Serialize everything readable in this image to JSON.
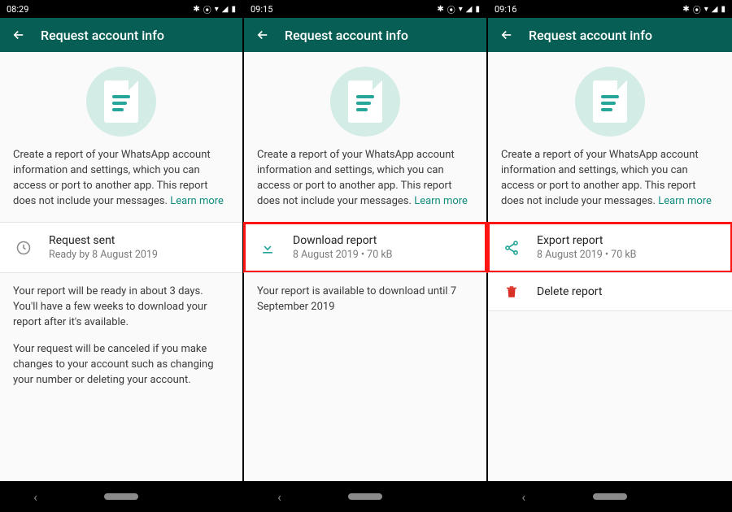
{
  "screens": [
    {
      "status_time": "08:29",
      "appbar_title": "Request account info",
      "description": "Create a report of your WhatsApp account information and settings, which you can access or port to another app. This report does not include your messages.",
      "learn_more": "Learn more",
      "item": {
        "icon": "clock",
        "primary": "Request sent",
        "secondary": "Ready by 8 August 2019",
        "highlighted": false
      },
      "note1": "Your report will be ready in about 3 days. You'll have a few weeks to download your report after it's available.",
      "note2": "Your request will be canceled if you make changes to your account such as changing your number or deleting your account."
    },
    {
      "status_time": "09:15",
      "appbar_title": "Request account info",
      "description": "Create a report of your WhatsApp account information and settings, which you can access or port to another app. This report does not include your messages.",
      "learn_more": "Learn more",
      "item": {
        "icon": "download",
        "primary": "Download report",
        "secondary": "8 August 2019 • 70 kB",
        "highlighted": true
      },
      "note1": "Your report is available to download until 7 September 2019",
      "note2": ""
    },
    {
      "status_time": "09:16",
      "appbar_title": "Request account info",
      "description": "Create a report of your WhatsApp account information and settings, which you can access or port to another app. This report does not include your messages.",
      "learn_more": "Learn more",
      "item": {
        "icon": "share",
        "primary": "Export report",
        "secondary": "8 August 2019 • 70 kB",
        "highlighted": true
      },
      "extra_item": {
        "icon": "trash",
        "primary": "Delete report"
      }
    }
  ],
  "colors": {
    "brand": "#075e54",
    "accent": "#128c7e",
    "highlight": "#ff1414"
  }
}
